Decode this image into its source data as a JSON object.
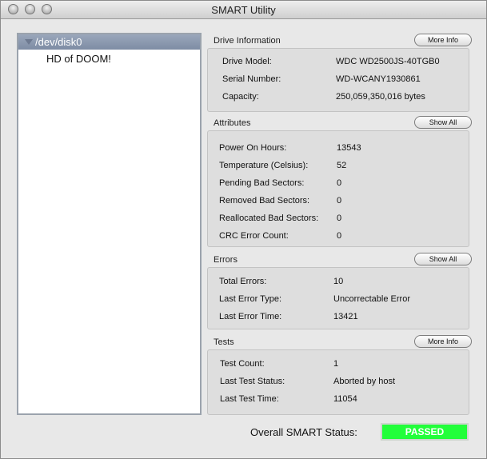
{
  "window": {
    "title": "SMART Utility"
  },
  "sidebar": {
    "disk_label": "/dev/disk0",
    "volume_label": "HD of DOOM!"
  },
  "sections": {
    "drive_info": {
      "title": "Drive Information",
      "button": "More Info",
      "rows": [
        {
          "label": "Drive Model:",
          "value": "WDC WD2500JS-40TGB0"
        },
        {
          "label": "Serial Number:",
          "value": "WD-WCANY1930861"
        },
        {
          "label": "Capacity:",
          "value": "250,059,350,016 bytes"
        }
      ]
    },
    "attributes": {
      "title": "Attributes",
      "button": "Show All",
      "rows": [
        {
          "label": "Power On Hours:",
          "value": "13543"
        },
        {
          "label": "Temperature (Celsius):",
          "value": "52"
        },
        {
          "label": "Pending Bad Sectors:",
          "value": "0"
        },
        {
          "label": "Removed Bad Sectors:",
          "value": "0"
        },
        {
          "label": "Reallocated Bad Sectors:",
          "value": "0"
        },
        {
          "label": "CRC Error Count:",
          "value": "0"
        }
      ]
    },
    "errors": {
      "title": "Errors",
      "button": "Show All",
      "rows": [
        {
          "label": "Total Errors:",
          "value": "10"
        },
        {
          "label": "Last Error Type:",
          "value": "Uncorrectable Error"
        },
        {
          "label": "Last Error Time:",
          "value": "13421"
        }
      ]
    },
    "tests": {
      "title": "Tests",
      "button": "More Info",
      "rows": [
        {
          "label": "Test Count:",
          "value": "1"
        },
        {
          "label": "Last Test Status:",
          "value": "Aborted by host"
        },
        {
          "label": "Last Test Time:",
          "value": "11054"
        }
      ]
    }
  },
  "overall": {
    "label": "Overall SMART Status:",
    "status": "PASSED",
    "status_color": "#22ff3a"
  }
}
